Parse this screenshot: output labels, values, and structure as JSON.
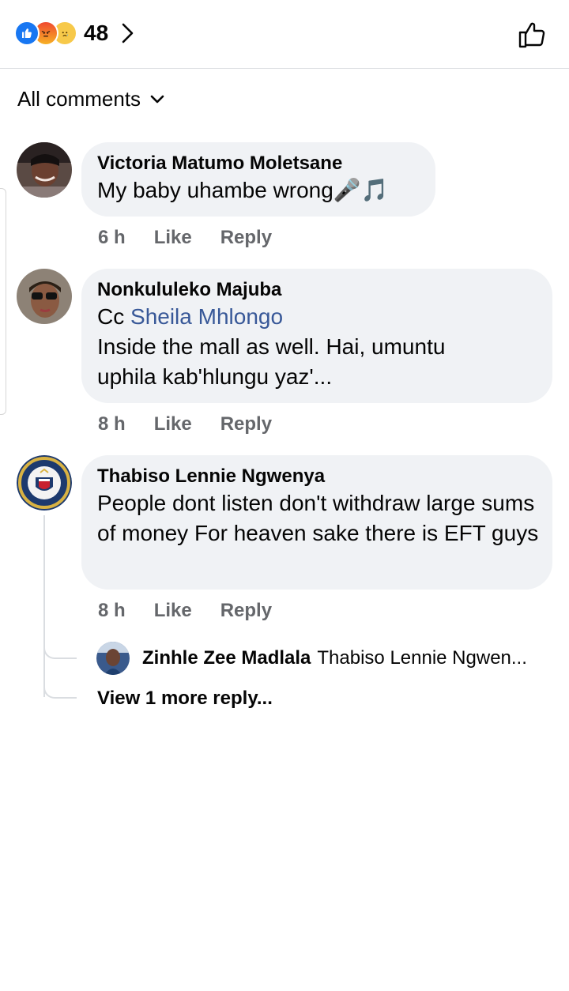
{
  "header": {
    "reactions": [
      "like-reaction",
      "angry-reaction",
      "sad-reaction"
    ],
    "reaction_count": "48",
    "like_button_icon": "thumbs-up-icon"
  },
  "filter": {
    "label": "All comments"
  },
  "comments": [
    {
      "author": "Victoria Matumo Moletsane",
      "text": "My baby uhambe wrong🎤🎵",
      "time": "6 h",
      "like": "Like",
      "reply": "Reply"
    },
    {
      "author": "Nonkululeko Majuba",
      "prefix": "Cc",
      "mention": "Sheila Mhlongo",
      "text_line2": "Inside the mall as well. Hai, umuntu",
      "text_line3": "uphila kab'hlungu yaz'...",
      "time": "8 h",
      "like": "Like",
      "reply": "Reply"
    },
    {
      "author": "Thabiso Lennie Ngwenya",
      "text": "People dont listen don't withdraw large sums of money For heaven sake there is EFT guys",
      "time": "8 h",
      "like": "Like",
      "reply": "Reply"
    }
  ],
  "reply_preview": {
    "author": "Zinhle Zee Madlala",
    "text": "Thabiso Lennie Ngwen..."
  },
  "view_more": "View 1 more reply...",
  "colors": {
    "link": "#385898",
    "bubble": "#f0f2f5",
    "meta": "#65676b",
    "like_blue": "#1877f2"
  }
}
